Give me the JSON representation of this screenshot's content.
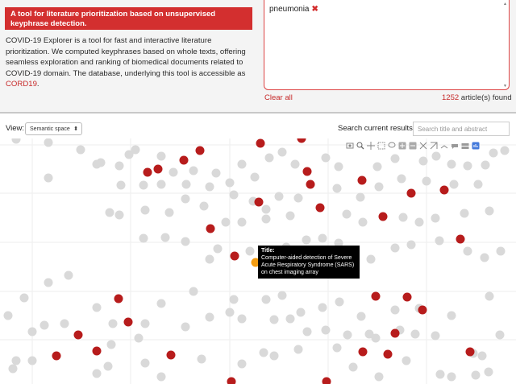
{
  "header": {
    "banner": "A tool for literature prioritization based on unsupervised keyphrase detection.",
    "description_text": "COVID-19 Explorer is a tool for fast and interactive literature prioritization. We computed keyphrases based on whole texts, offering seamless exploration and ranking of biomedical documents related to COVID-19 domain. The database, underlying this tool is accessible as ",
    "description_link": "CORD19",
    "description_end": "."
  },
  "query": {
    "tag": "pneumonia",
    "remove_glyph": "✖",
    "clear_label": "Clear all",
    "count": "1252",
    "count_suffix": " article(s) found"
  },
  "controls": {
    "view_label": "View:",
    "view_value": "Semantic space",
    "search_label": "Search current results:",
    "search_placeholder": "Search title and abstract"
  },
  "toolbar_icons": [
    "save-icon",
    "zoom-icon",
    "pan-icon",
    "box-select-icon",
    "lasso-icon",
    "zoom-in-icon",
    "zoom-out-icon",
    "autoscale-icon",
    "reset-axes-icon",
    "spike-lines-icon",
    "hover-closest-icon",
    "hover-compare-icon",
    "plotly-logo-icon"
  ],
  "tooltip": {
    "label": "Title:",
    "text": "Computer-aided detection of Severe Acute Respiratory Syndrome (SARS) on chest imaging array"
  },
  "colors": {
    "accent": "#d32f2f",
    "relevant": "#b71c1c",
    "other": "#d9d9d9",
    "highlight": "#f39c12"
  },
  "chart_data": {
    "type": "scatter",
    "x_range": [
      0,
      640
    ],
    "y_range": [
      0,
      305
    ],
    "grid": true,
    "series": [
      {
        "name": "",
        "color": "#b71c1c",
        "points": [
          [
            248,
            15
          ],
          [
            323,
            6
          ],
          [
            374,
            0
          ],
          [
            183,
            42
          ],
          [
            196,
            38
          ],
          [
            228,
            27
          ],
          [
            381,
            41
          ],
          [
            449,
            52
          ],
          [
            385,
            57
          ],
          [
            321,
            79
          ],
          [
            551,
            64
          ],
          [
            475,
            97
          ],
          [
            397,
            86
          ],
          [
            510,
            68
          ],
          [
            261,
            112
          ],
          [
            571,
            125
          ],
          [
            291,
            146
          ],
          [
            147,
            199
          ],
          [
            159,
            228
          ],
          [
            466,
            196
          ],
          [
            505,
            197
          ],
          [
            524,
            213
          ],
          [
            97,
            244
          ],
          [
            120,
            264
          ],
          [
            70,
            270
          ],
          [
            212,
            269
          ],
          [
            450,
            265
          ],
          [
            481,
            268
          ],
          [
            490,
            242
          ],
          [
            583,
            265
          ],
          [
            287,
            302
          ],
          [
            405,
            302
          ]
        ]
      },
      {
        "name": "",
        "color": "#d9d9d9",
        "points": [
          [
            20,
            1
          ],
          [
            60,
            5
          ],
          [
            100,
            14
          ],
          [
            125,
            30
          ],
          [
            148,
            34
          ],
          [
            160,
            20
          ],
          [
            168,
            14
          ],
          [
            200,
            22
          ],
          [
            215,
            42
          ],
          [
            240,
            40
          ],
          [
            268,
            43
          ],
          [
            285,
            55
          ],
          [
            300,
            32
          ],
          [
            316,
            48
          ],
          [
            334,
            24
          ],
          [
            350,
            17
          ],
          [
            366,
            32
          ],
          [
            404,
            24
          ],
          [
            420,
            35
          ],
          [
            468,
            35
          ],
          [
            490,
            25
          ],
          [
            525,
            28
          ],
          [
            541,
            22
          ],
          [
            560,
            32
          ],
          [
            580,
            34
          ],
          [
            602,
            33
          ],
          [
            612,
            18
          ],
          [
            626,
            15
          ],
          [
            120,
            32
          ],
          [
            60,
            49
          ],
          [
            150,
            58
          ],
          [
            178,
            58
          ],
          [
            200,
            57
          ],
          [
            231,
            57
          ],
          [
            260,
            60
          ],
          [
            290,
            70
          ],
          [
            314,
            78
          ],
          [
            330,
            88
          ],
          [
            346,
            72
          ],
          [
            370,
            74
          ],
          [
            418,
            62
          ],
          [
            447,
            73
          ],
          [
            470,
            60
          ],
          [
            498,
            50
          ],
          [
            529,
            53
          ],
          [
            563,
            57
          ],
          [
            593,
            57
          ],
          [
            607,
            90
          ],
          [
            136,
            92
          ],
          [
            148,
            95
          ],
          [
            180,
            89
          ],
          [
            210,
            92
          ],
          [
            230,
            75
          ],
          [
            253,
            84
          ],
          [
            280,
            104
          ],
          [
            300,
            104
          ],
          [
            330,
            100
          ],
          [
            360,
            96
          ],
          [
            430,
            94
          ],
          [
            450,
            104
          ],
          [
            500,
            98
          ],
          [
            520,
            104
          ],
          [
            540,
            99
          ],
          [
            576,
            93
          ],
          [
            178,
            124
          ],
          [
            205,
            123
          ],
          [
            230,
            128
          ],
          [
            260,
            150
          ],
          [
            270,
            137
          ],
          [
            310,
            140
          ],
          [
            355,
            135
          ],
          [
            380,
            126
          ],
          [
            400,
            124
          ],
          [
            420,
            130
          ],
          [
            440,
            145
          ],
          [
            460,
            150
          ],
          [
            490,
            136
          ],
          [
            510,
            132
          ],
          [
            545,
            127
          ],
          [
            580,
            140
          ],
          [
            601,
            148
          ],
          [
            621,
            140
          ],
          [
            30,
            198
          ],
          [
            60,
            179
          ],
          [
            85,
            170
          ],
          [
            120,
            210
          ],
          [
            140,
            230
          ],
          [
            180,
            230
          ],
          [
            200,
            205
          ],
          [
            240,
            190
          ],
          [
            290,
            200
          ],
          [
            330,
            200
          ],
          [
            350,
            195
          ],
          [
            373,
            216
          ],
          [
            400,
            210
          ],
          [
            421,
            203
          ],
          [
            448,
            221
          ],
          [
            490,
            213
          ],
          [
            520,
            211
          ],
          [
            560,
            220
          ],
          [
            607,
            196
          ],
          [
            10,
            220
          ],
          [
            40,
            240
          ],
          [
            55,
            232
          ],
          [
            80,
            230
          ],
          [
            138,
            256
          ],
          [
            172,
            248
          ],
          [
            230,
            234
          ],
          [
            260,
            222
          ],
          [
            285,
            216
          ],
          [
            300,
            224
          ],
          [
            340,
            225
          ],
          [
            360,
            224
          ],
          [
            381,
            240
          ],
          [
            404,
            238
          ],
          [
            431,
            244
          ],
          [
            458,
            243
          ],
          [
            466,
            248
          ],
          [
            496,
            238
          ],
          [
            515,
            243
          ],
          [
            540,
            245
          ],
          [
            587,
            267
          ],
          [
            598,
            270
          ],
          [
            620,
            244
          ],
          [
            20,
            276
          ],
          [
            40,
            276
          ],
          [
            120,
            292
          ],
          [
            134,
            283
          ],
          [
            180,
            279
          ],
          [
            200,
            296
          ],
          [
            250,
            274
          ],
          [
            300,
            280
          ],
          [
            327,
            266
          ],
          [
            340,
            270
          ],
          [
            370,
            262
          ],
          [
            418,
            260
          ],
          [
            438,
            284
          ],
          [
            470,
            296
          ],
          [
            504,
            276
          ],
          [
            546,
            293
          ],
          [
            560,
            296
          ],
          [
            590,
            294
          ],
          [
            606,
            290
          ],
          [
            16,
            286
          ]
        ]
      },
      {
        "name": "",
        "color": "#f39c12",
        "points": [
          [
            317,
            154
          ]
        ]
      }
    ]
  }
}
